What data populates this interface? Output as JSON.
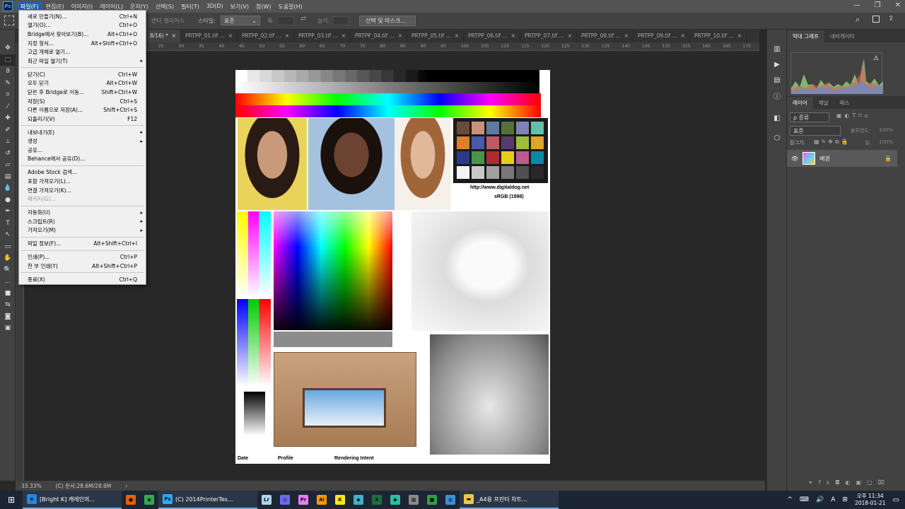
{
  "menubar": {
    "items": [
      "파일(F)",
      "편집(E)",
      "이미지(I)",
      "레이어(L)",
      "문자(Y)",
      "선택(S)",
      "필터(T)",
      "3D(D)",
      "보기(V)",
      "창(W)",
      "도움말(H)"
    ],
    "logo": "Ps",
    "window_controls": [
      "—",
      "❐",
      "✕"
    ]
  },
  "optionsbar": {
    "partial_label": "앤티 앨리어스",
    "style_label": "스타일:",
    "style_value": "표준",
    "width_label": "폭:",
    "height_label": "높이:",
    "select_mask_button": "선택 및 마스크..."
  },
  "tabs": [
    {
      "label": "8/16) *",
      "active": true
    },
    {
      "label": "PRTPP_01.tif ..."
    },
    {
      "label": "PRTPP_02.tif ..."
    },
    {
      "label": "PRTPP_03.tif ..."
    },
    {
      "label": "PRTPP_04.tif ..."
    },
    {
      "label": "PRTPP_05.tif ..."
    },
    {
      "label": "PRTPP_06.tif ..."
    },
    {
      "label": "PRTPP_07.tif ..."
    },
    {
      "label": "PRTPP_08.tif ..."
    },
    {
      "label": "PRTPP_09.tif ..."
    },
    {
      "label": "PRTPP_10.tif ..."
    }
  ],
  "ruler_ticks": [
    "25",
    "30",
    "35",
    "40",
    "45",
    "50",
    "55",
    "60",
    "65",
    "70",
    "75",
    "80",
    "85",
    "90",
    "95",
    "100",
    "105",
    "110",
    "115",
    "120",
    "125",
    "130",
    "135",
    "140",
    "145",
    "150",
    "155",
    "160",
    "165",
    "170"
  ],
  "file_menu": [
    {
      "label": "새로 만들기(N)...",
      "sc": "Ctrl+N"
    },
    {
      "label": "열기(O)...",
      "sc": "Ctrl+O"
    },
    {
      "label": "Bridge에서 찾아보기(B)...",
      "sc": "Alt+Ctrl+O"
    },
    {
      "label": "지정 형식...",
      "sc": "Alt+Shift+Ctrl+O"
    },
    {
      "label": "고급 개체로 열기...",
      "sc": ""
    },
    {
      "label": "최근 파일 열기(T)",
      "sc": "",
      "sub": true
    },
    {
      "sep": true
    },
    {
      "label": "닫기(C)",
      "sc": "Ctrl+W"
    },
    {
      "label": "모두 닫기",
      "sc": "Alt+Ctrl+W"
    },
    {
      "label": "닫은 후 Bridge로 이동...",
      "sc": "Shift+Ctrl+W"
    },
    {
      "label": "저장(S)",
      "sc": "Ctrl+S"
    },
    {
      "label": "다른 이름으로 저장(A)...",
      "sc": "Shift+Ctrl+S"
    },
    {
      "label": "되돌리기(V)",
      "sc": "F12"
    },
    {
      "sep": true
    },
    {
      "label": "내보내기(E)",
      "sc": "",
      "sub": true
    },
    {
      "label": "생성",
      "sc": "",
      "sub": true
    },
    {
      "label": "공유...",
      "sc": ""
    },
    {
      "label": "Behance에서 공유(D)...",
      "sc": ""
    },
    {
      "sep": true
    },
    {
      "label": "Adobe Stock 검색...",
      "sc": ""
    },
    {
      "label": "포함 가져오기(L)...",
      "sc": ""
    },
    {
      "label": "연결 가져오기(K)...",
      "sc": ""
    },
    {
      "label": "패키지(G)...",
      "sc": "",
      "disabled": true
    },
    {
      "sep": true
    },
    {
      "label": "자동화(U)",
      "sc": "",
      "sub": true
    },
    {
      "label": "스크립트(R)",
      "sc": "",
      "sub": true
    },
    {
      "label": "가져오기(M)",
      "sc": "",
      "sub": true
    },
    {
      "sep": true
    },
    {
      "label": "파일 정보(F)...",
      "sc": "Alt+Shift+Ctrl+I"
    },
    {
      "sep": true
    },
    {
      "label": "인쇄(P)...",
      "sc": "Ctrl+P"
    },
    {
      "label": "한 부 인쇄(Y)",
      "sc": "Alt+Shift+Ctrl+P"
    },
    {
      "sep": true
    },
    {
      "label": "종료(X)",
      "sc": "Ctrl+Q"
    }
  ],
  "document": {
    "url_text": "http://www.digitaldog.net",
    "profile_text": "sRGB (1998)",
    "footer": [
      "Date",
      "Profile",
      "Rendering Intent"
    ]
  },
  "status": {
    "zoom": "33.33%",
    "doc_size": "(C) 문서:28.6M/28.6M",
    "arrow": "›"
  },
  "panels": {
    "top_tabs": [
      "막대 그래프",
      "내비게이터"
    ],
    "layer_tabs": [
      "레이어",
      "채널",
      "패스"
    ],
    "kind_filter": "ρ 종류",
    "blend_mode": "표준",
    "opacity_label": "불투명도:",
    "opacity_value": "100%",
    "lock_label": "잠그기:",
    "fill_label": "칠:",
    "fill_value": "100%",
    "layer_name": "배경"
  },
  "taskbar": {
    "apps": [
      {
        "label": "[Bright K] 캐레인의...",
        "icon": "e",
        "color": "#1e88e5"
      },
      {
        "label": "",
        "icon": "●",
        "color": "#e66000"
      },
      {
        "label": "",
        "icon": "◉",
        "color": "#34a853"
      },
      {
        "label": "(C) 2014PrinterTes...",
        "icon": "Ps",
        "color": "#31a8ff",
        "open": true
      },
      {
        "label": "",
        "icon": "Lr",
        "color": "#add5ec"
      },
      {
        "label": "",
        "icon": "◎",
        "color": "#6a6af0"
      },
      {
        "label": "",
        "icon": "Pr",
        "color": "#e77cff"
      },
      {
        "label": "",
        "icon": "Ai",
        "color": "#ff9a00"
      },
      {
        "label": "",
        "icon": "K",
        "color": "#ffe812"
      },
      {
        "label": "",
        "icon": "◆",
        "color": "#3bb3c3"
      },
      {
        "label": "",
        "icon": "X",
        "color": "#1d6f42"
      },
      {
        "label": "",
        "icon": "◆",
        "color": "#28c0a0"
      },
      {
        "label": "",
        "icon": "▦",
        "color": "#8a8a8a"
      },
      {
        "label": "",
        "icon": "■",
        "color": "#2ea043"
      },
      {
        "label": "",
        "icon": "◍",
        "color": "#3d8fd6"
      },
      {
        "label": "_A4용 프린터 차트...",
        "icon": "▬",
        "color": "#f2c744"
      }
    ],
    "time": "오후 11:34",
    "date": "2018-01-21",
    "tray": [
      "^",
      "⌨",
      "🔊",
      "A",
      "⊞"
    ]
  }
}
